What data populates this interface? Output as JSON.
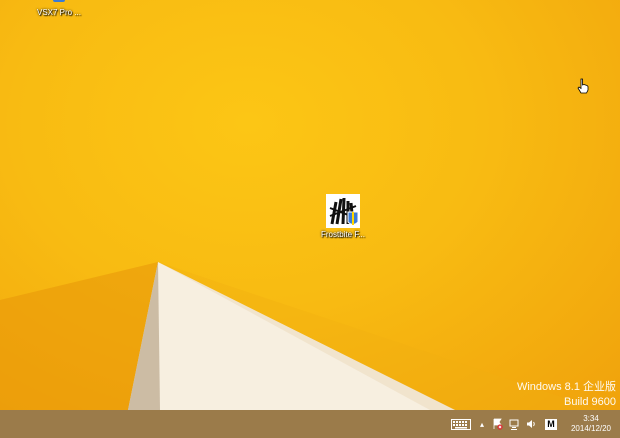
{
  "desktop": {
    "icons": [
      {
        "label": "VSX7 Pro ..."
      },
      {
        "label": "Frostbite F..."
      }
    ],
    "watermark": {
      "line1": "Windows 8.1 企业版",
      "line2": "Build 9600"
    }
  },
  "taskbar": {
    "tray": {
      "keyboard_icon": "keyboard-icon",
      "show_hidden_glyph": "▴",
      "ime_label": "M",
      "clock": {
        "time": "3:34",
        "date": "2014/12/20"
      }
    }
  },
  "colors": {
    "wallpaper": "#f8bb12",
    "taskbar": "#9b7b4a",
    "paper": "#f7efe0"
  }
}
